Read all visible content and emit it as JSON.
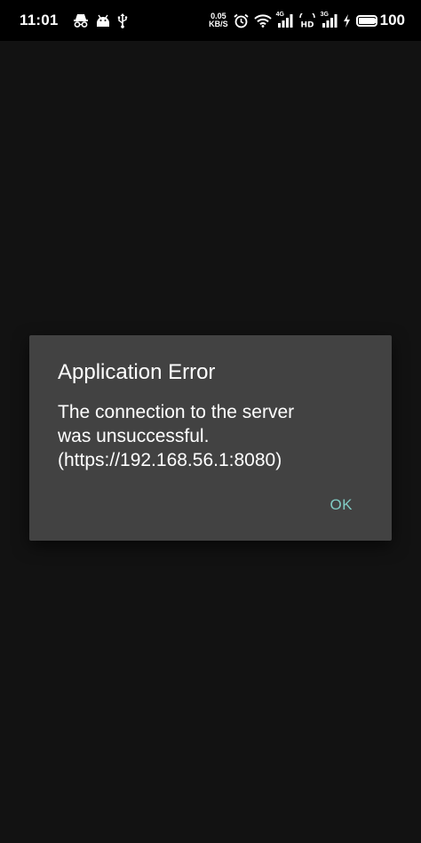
{
  "status_bar": {
    "time": "11:01",
    "net_speed_value": "0.05",
    "net_speed_unit": "KB/S",
    "signal1_tag": "4G",
    "hd_label": "HD",
    "signal2_tag": "3G",
    "battery_level": "100",
    "icons": [
      "incognito-icon",
      "android-icon",
      "usb-icon",
      "alarm-icon",
      "wifi-icon",
      "signal-icon",
      "signal-icon",
      "charging-icon",
      "battery-icon"
    ]
  },
  "dialog": {
    "title": "Application Error",
    "message": "The connection to the server was unsuccessful. (https://192.168.56.1:8080)",
    "ok_label": "OK"
  },
  "colors": {
    "background": "#121212",
    "status_bar": "#000000",
    "dialog_bg": "#424242",
    "accent": "#80cbc4",
    "text": "#ffffff"
  }
}
